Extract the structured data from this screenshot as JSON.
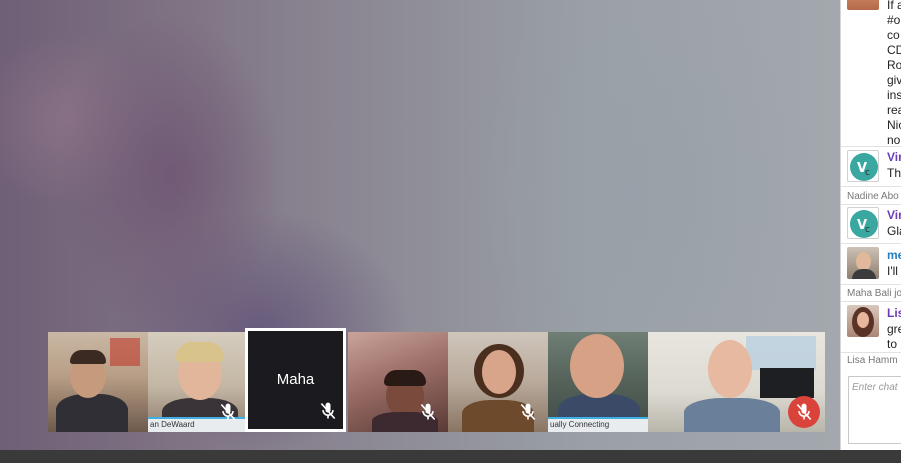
{
  "participants": [
    {
      "name": "",
      "caption": ""
    },
    {
      "name": "",
      "caption": "an DeWaard"
    },
    {
      "name": "Maha",
      "caption": ""
    },
    {
      "name": "",
      "caption": ""
    },
    {
      "name": "",
      "caption": ""
    },
    {
      "name": "",
      "caption": "ually Connecting"
    },
    {
      "name": "",
      "caption": ""
    },
    {
      "name": "",
      "caption": ""
    }
  ],
  "chat": {
    "long_message_lines": [
      "If a",
      "#o",
      "co",
      "CD",
      "Ro",
      "giv",
      "ins",
      "rea",
      "Nic",
      "no"
    ],
    "messages": [
      {
        "sender": "Vir",
        "text": "Th",
        "sender_color": "#6a3fb5"
      },
      {
        "sender": "Vir",
        "text": "Gla",
        "sender_color": "#6a3fb5"
      },
      {
        "sender": "me",
        "text": "I'll",
        "sender_color": "#2a7fbf"
      },
      {
        "sender": "Lis",
        "text_lines": [
          "gre",
          "to"
        ],
        "sender_color": "#6a3fb5"
      }
    ],
    "system_messages": [
      "Nadine Abo",
      "Maha Bali jo",
      "Lisa Hamm"
    ],
    "input_placeholder": "Enter chat"
  },
  "colors": {
    "mute_red": "#d9433a",
    "caption_accent": "#3fb0e6",
    "selected_border": "#ffffff"
  },
  "icons": {
    "mute": "microphone-off-icon"
  }
}
